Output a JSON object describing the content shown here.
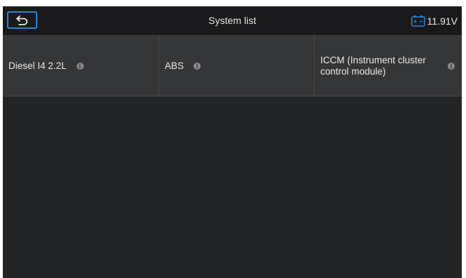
{
  "header": {
    "title": "System list",
    "battery_voltage": "11.91V",
    "back_icon": "back-arrow-icon",
    "battery_icon": "battery-icon"
  },
  "systems": [
    {
      "label": "Diesel I4 2.2L",
      "info_icon": "info-icon"
    },
    {
      "label": "ABS",
      "info_icon": "info-icon"
    },
    {
      "label": "ICCM (Instrument cluster control module)",
      "info_icon": "info-icon"
    }
  ],
  "colors": {
    "accent": "#2a84d6",
    "background": "#232426",
    "cell": "#353638",
    "topbar": "#1a1a1c"
  }
}
